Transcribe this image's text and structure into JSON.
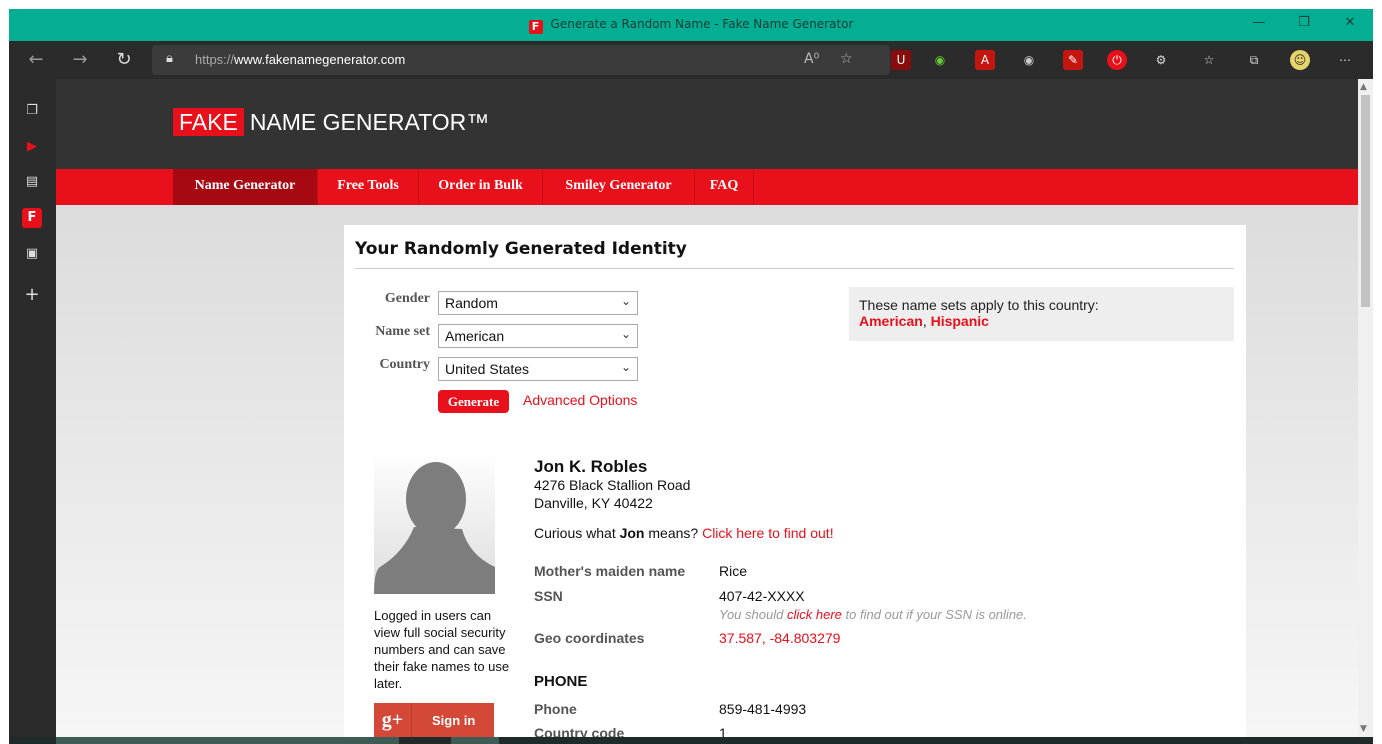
{
  "window": {
    "title": "Generate a Random Name - Fake Name Generator",
    "favicon_letter": "F"
  },
  "browser": {
    "url_prefix": "https://",
    "url_domain": "www.fakenamegenerator.com"
  },
  "site": {
    "logo_fake": "FAKE",
    "logo_rest": "NAME GENERATOR™",
    "nav": [
      "Name Generator",
      "Free Tools",
      "Order in Bulk",
      "Smiley Generator",
      "FAQ"
    ]
  },
  "form": {
    "heading": "Your Randomly Generated Identity",
    "gender_label": "Gender",
    "gender_value": "Random",
    "nameset_label": "Name set",
    "nameset_value": "American",
    "country_label": "Country",
    "country_value": "United States",
    "generate_label": "Generate",
    "advanced_label": "Advanced Options"
  },
  "info": {
    "text": "These name sets apply to this country:",
    "set1": "American",
    "sep": ",",
    "set2": "Hispanic"
  },
  "identity": {
    "name": "Jon K. Robles",
    "street": "4276 Black Stallion Road",
    "city": "Danville, KY 40422",
    "curious_pre": "Curious what",
    "curious_name": "Jon",
    "curious_post": "means?",
    "curious_link": "Click here to find out!",
    "maiden_label": "Mother's maiden name",
    "maiden_value": "Rice",
    "ssn_label": "SSN",
    "ssn_value": "407-42-XXXX",
    "ssn_note_pre": "You should",
    "ssn_note_link": "click here",
    "ssn_note_post": "to find out if your SSN is online.",
    "geo_label": "Geo coordinates",
    "geo_value": "37.587, -84.803279",
    "phone_section": "PHONE",
    "phone_label": "Phone",
    "phone_value": "859-481-4993",
    "cc_label": "Country code",
    "cc_value": "1"
  },
  "login": {
    "text": "Logged in users can view full social security numbers and can save their fake names to use later.",
    "gplus": "g+",
    "signin": "Sign in"
  },
  "colors": {
    "brand_red": "#e8101b",
    "header_dark": "#333333",
    "titlebar": "#04ae93"
  }
}
